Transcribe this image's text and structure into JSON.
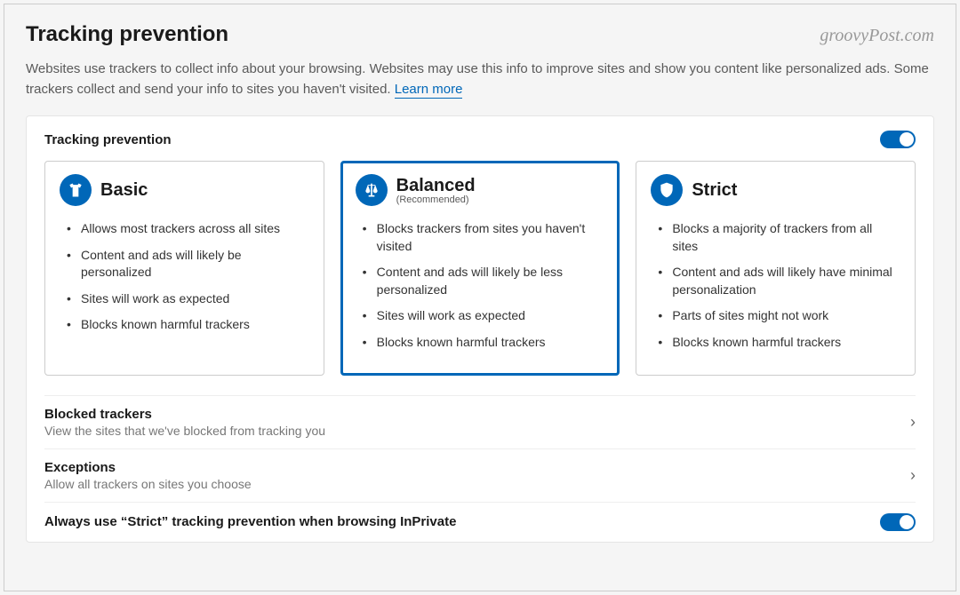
{
  "watermark": "groovyPost.com",
  "page": {
    "title": "Tracking prevention",
    "description": "Websites use trackers to collect info about your browsing. Websites may use this info to improve sites and show you content like personalized ads. Some trackers collect and send your info to sites you haven't visited.",
    "learn_more": "Learn more"
  },
  "panel": {
    "header": "Tracking prevention",
    "toggle_on": true
  },
  "cards": {
    "basic": {
      "title": "Basic",
      "bullets": [
        "Allows most trackers across all sites",
        "Content and ads will likely be personalized",
        "Sites will work as expected",
        "Blocks known harmful trackers"
      ]
    },
    "balanced": {
      "title": "Balanced",
      "subtitle": "(Recommended)",
      "bullets": [
        "Blocks trackers from sites you haven't visited",
        "Content and ads will likely be less personalized",
        "Sites will work as expected",
        "Blocks known harmful trackers"
      ]
    },
    "strict": {
      "title": "Strict",
      "bullets": [
        "Blocks a majority of trackers from all sites",
        "Content and ads will likely have minimal personalization",
        "Parts of sites might not work",
        "Blocks known harmful trackers"
      ]
    }
  },
  "rows": {
    "blocked": {
      "title": "Blocked trackers",
      "desc": "View the sites that we've blocked from tracking you"
    },
    "exceptions": {
      "title": "Exceptions",
      "desc": "Allow all trackers on sites you choose"
    },
    "inprivate": {
      "title": "Always use “Strict” tracking prevention when browsing InPrivate"
    }
  }
}
